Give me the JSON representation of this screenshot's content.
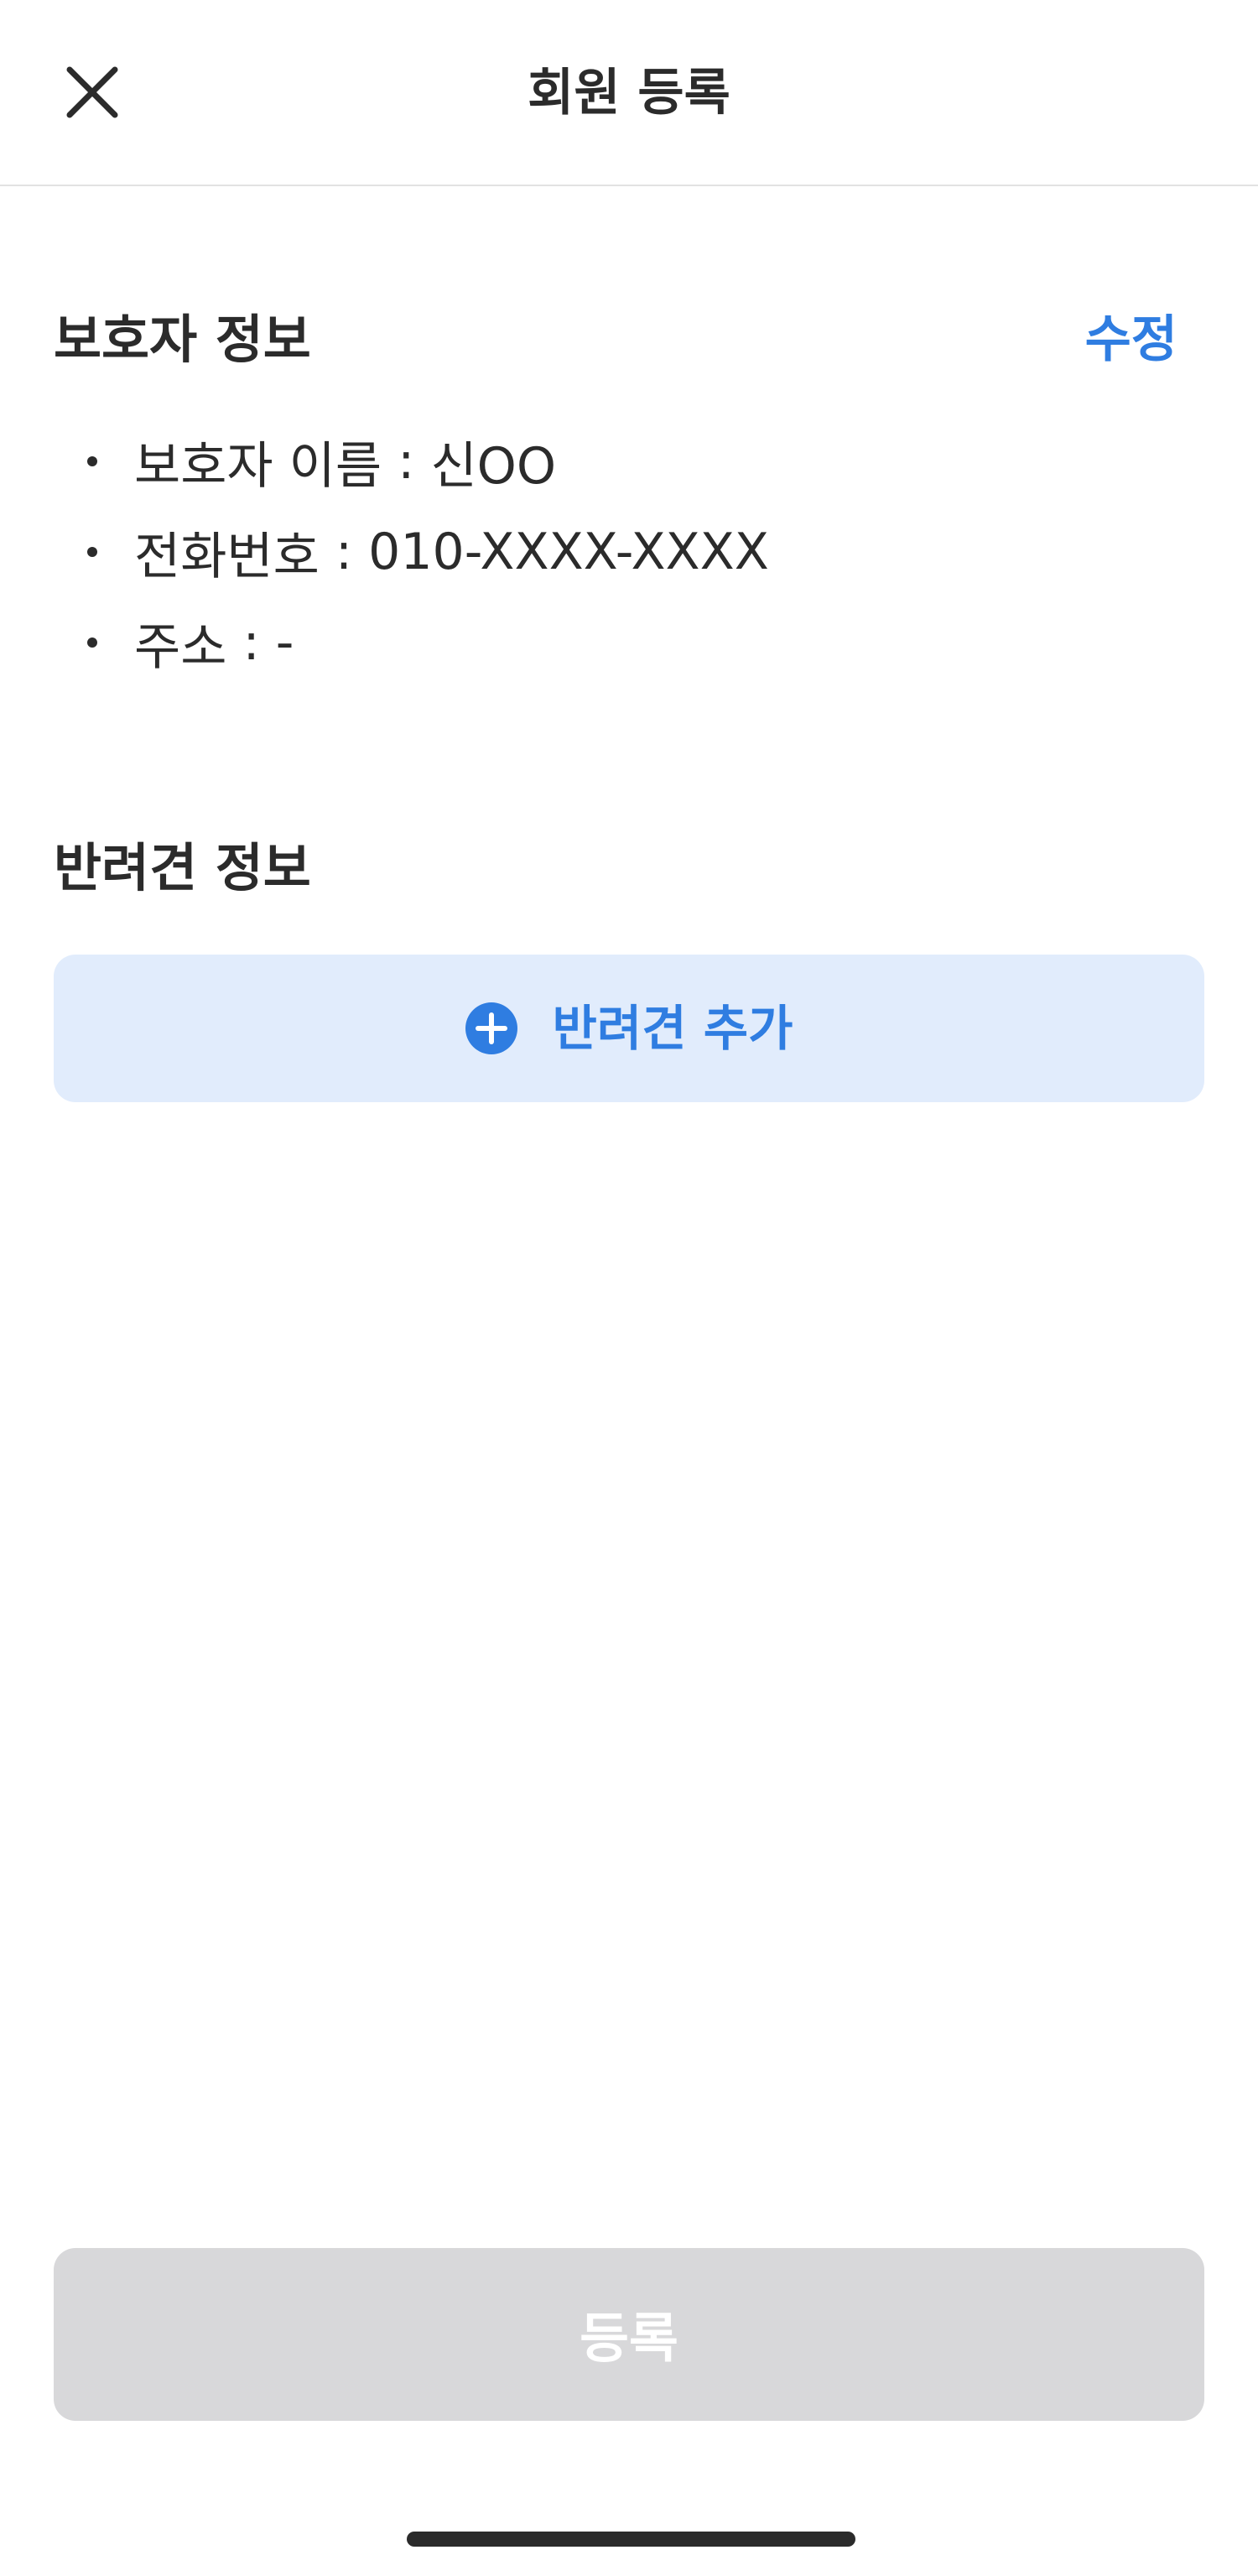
{
  "header": {
    "title": "회원 등록",
    "close_icon": "close-icon"
  },
  "guardian": {
    "title": "보호자 정보",
    "edit_label": "수정",
    "items": [
      {
        "label": "보호자 이름",
        "separator": " : ",
        "value": "신OO"
      },
      {
        "label": "전화번호",
        "separator": " : ",
        "value": "010-XXXX-XXXX"
      },
      {
        "label": "주소",
        "separator": " : ",
        "value": "-"
      }
    ]
  },
  "pet": {
    "title": "반려견 정보",
    "add_label": "반려견 추가",
    "add_icon": "plus-circle-icon"
  },
  "submit": {
    "label": "등록",
    "enabled": false
  },
  "colors": {
    "accent": "#2f7de1",
    "accent_bg": "#e1ecfc",
    "disabled_bg": "#d8d8da",
    "text": "#2b2b2b"
  }
}
